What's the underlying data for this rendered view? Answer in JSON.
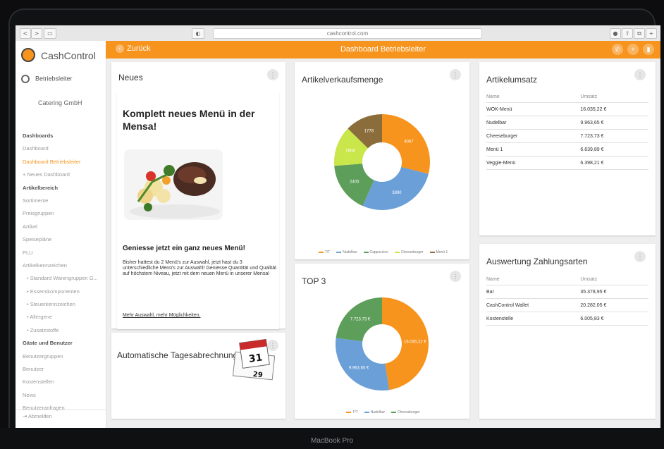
{
  "browser": {
    "url": "cashcontrol.com",
    "nav_back": "<",
    "nav_forward": ">",
    "reload": "◐"
  },
  "sidebar": {
    "logo_text": "CashControl",
    "user_label": "Betriebsleiter",
    "company": "Catering GmbH",
    "items": [
      {
        "label": "Dashboards",
        "type": "header"
      },
      {
        "label": "Dashboard",
        "type": "item"
      },
      {
        "label": "Dashboard Betriebsleiter",
        "type": "active"
      },
      {
        "label": "+ Neues Dashboard",
        "type": "item"
      },
      {
        "label": "Artikelbereich",
        "type": "header"
      },
      {
        "label": "Sortimente",
        "type": "item"
      },
      {
        "label": "Preisgruppen",
        "type": "item"
      },
      {
        "label": "Artikel",
        "type": "item"
      },
      {
        "label": "Speisepläne",
        "type": "item"
      },
      {
        "label": "PLU",
        "type": "item"
      },
      {
        "label": "Artikelkennzeichen",
        "type": "item"
      },
      {
        "label": "• Standard Warengruppen G...",
        "type": "sub"
      },
      {
        "label": "• Essenskomponenten",
        "type": "sub"
      },
      {
        "label": "• Steuerkennzeichen",
        "type": "sub"
      },
      {
        "label": "• Allergene",
        "type": "sub"
      },
      {
        "label": "• Zusatzstoffe",
        "type": "sub"
      },
      {
        "label": "Gäste und Benutzer",
        "type": "header"
      },
      {
        "label": "Benutzergruppen",
        "type": "item"
      },
      {
        "label": "Benutzer",
        "type": "item"
      },
      {
        "label": "Kostenstellen",
        "type": "item"
      },
      {
        "label": "News",
        "type": "item"
      },
      {
        "label": "Benutzeranfragen",
        "type": "item"
      }
    ],
    "logout": "Abmelden"
  },
  "appbar": {
    "back": "Zurück",
    "title": "Dashboard Betriebsleiter",
    "accent": "#f7941d"
  },
  "news": {
    "title": "Neues",
    "headline": "Komplett neues Menü in der Mensa!",
    "subheadline": "Geniesse jetzt ein ganz neues Menü!",
    "body": "Bisher hattest du 2 Menü's zur Auswahl, jetzt hast du 3 unterschiedliche Menü's zur Auswahl! Geniesse Quantität und Qualität auf höchstem Niveau, jetzt mit dem neuen Menü in unserer Mensa!",
    "link": "Mehr Auswahl, mehr Möglichkeiten."
  },
  "auto_card": {
    "title": "Automatische Tagesabrechnung",
    "cal_top": "31",
    "cal_bottom": "29"
  },
  "chart_data": [
    {
      "type": "pie",
      "title": "Artikelverkaufsmenge",
      "series": [
        {
          "name": "T/T",
          "value": 4067,
          "color": "#f7941d"
        },
        {
          "name": "Nudelbar",
          "value": 3890,
          "color": "#6a9fd8"
        },
        {
          "name": "Cappuccino",
          "value": 2405,
          "color": "#5c9e5a"
        },
        {
          "name": "Cheeseburger",
          "value": 1908,
          "color": "#c9e64a"
        },
        {
          "name": "Menü 1",
          "value": 1778,
          "color": "#8a6d3b"
        }
      ],
      "labels": [
        "4067",
        "3890",
        "2405",
        "1908",
        "1778"
      ]
    },
    {
      "type": "pie",
      "title": "TOP 3",
      "series": [
        {
          "name": "T/T",
          "value": 16035.22,
          "color": "#f7941d"
        },
        {
          "name": "Nudelbar",
          "value": 9963.65,
          "color": "#6a9fd8"
        },
        {
          "name": "Cheeseburger",
          "value": 7723.73,
          "color": "#5c9e5a"
        }
      ],
      "labels": [
        "16.035,22 €",
        "9.963,65 €",
        "7.723,73 €"
      ]
    }
  ],
  "artikelumsatz": {
    "title": "Artikelumsatz",
    "headers": [
      "Name",
      "Umsatz"
    ],
    "rows": [
      [
        "WOK-Menü",
        "16.035,22 €"
      ],
      [
        "Nudelbar",
        "9.963,65 €"
      ],
      [
        "Cheeseburger",
        "7.723,73 €"
      ],
      [
        "Menü 1",
        "6.639,89 €"
      ],
      [
        "Veggie-Menü",
        "6.398,21 €"
      ]
    ]
  },
  "zahlungsarten": {
    "title": "Auswertung Zahlungsarten",
    "headers": [
      "Name",
      "Umsatz"
    ],
    "rows": [
      [
        "Bar",
        "35.378,95 €"
      ],
      [
        "CashControl Wallet",
        "20.282,05 €"
      ],
      [
        "Kostenstelle",
        "6.005,83 €"
      ]
    ]
  },
  "device_label": "MacBook Pro"
}
